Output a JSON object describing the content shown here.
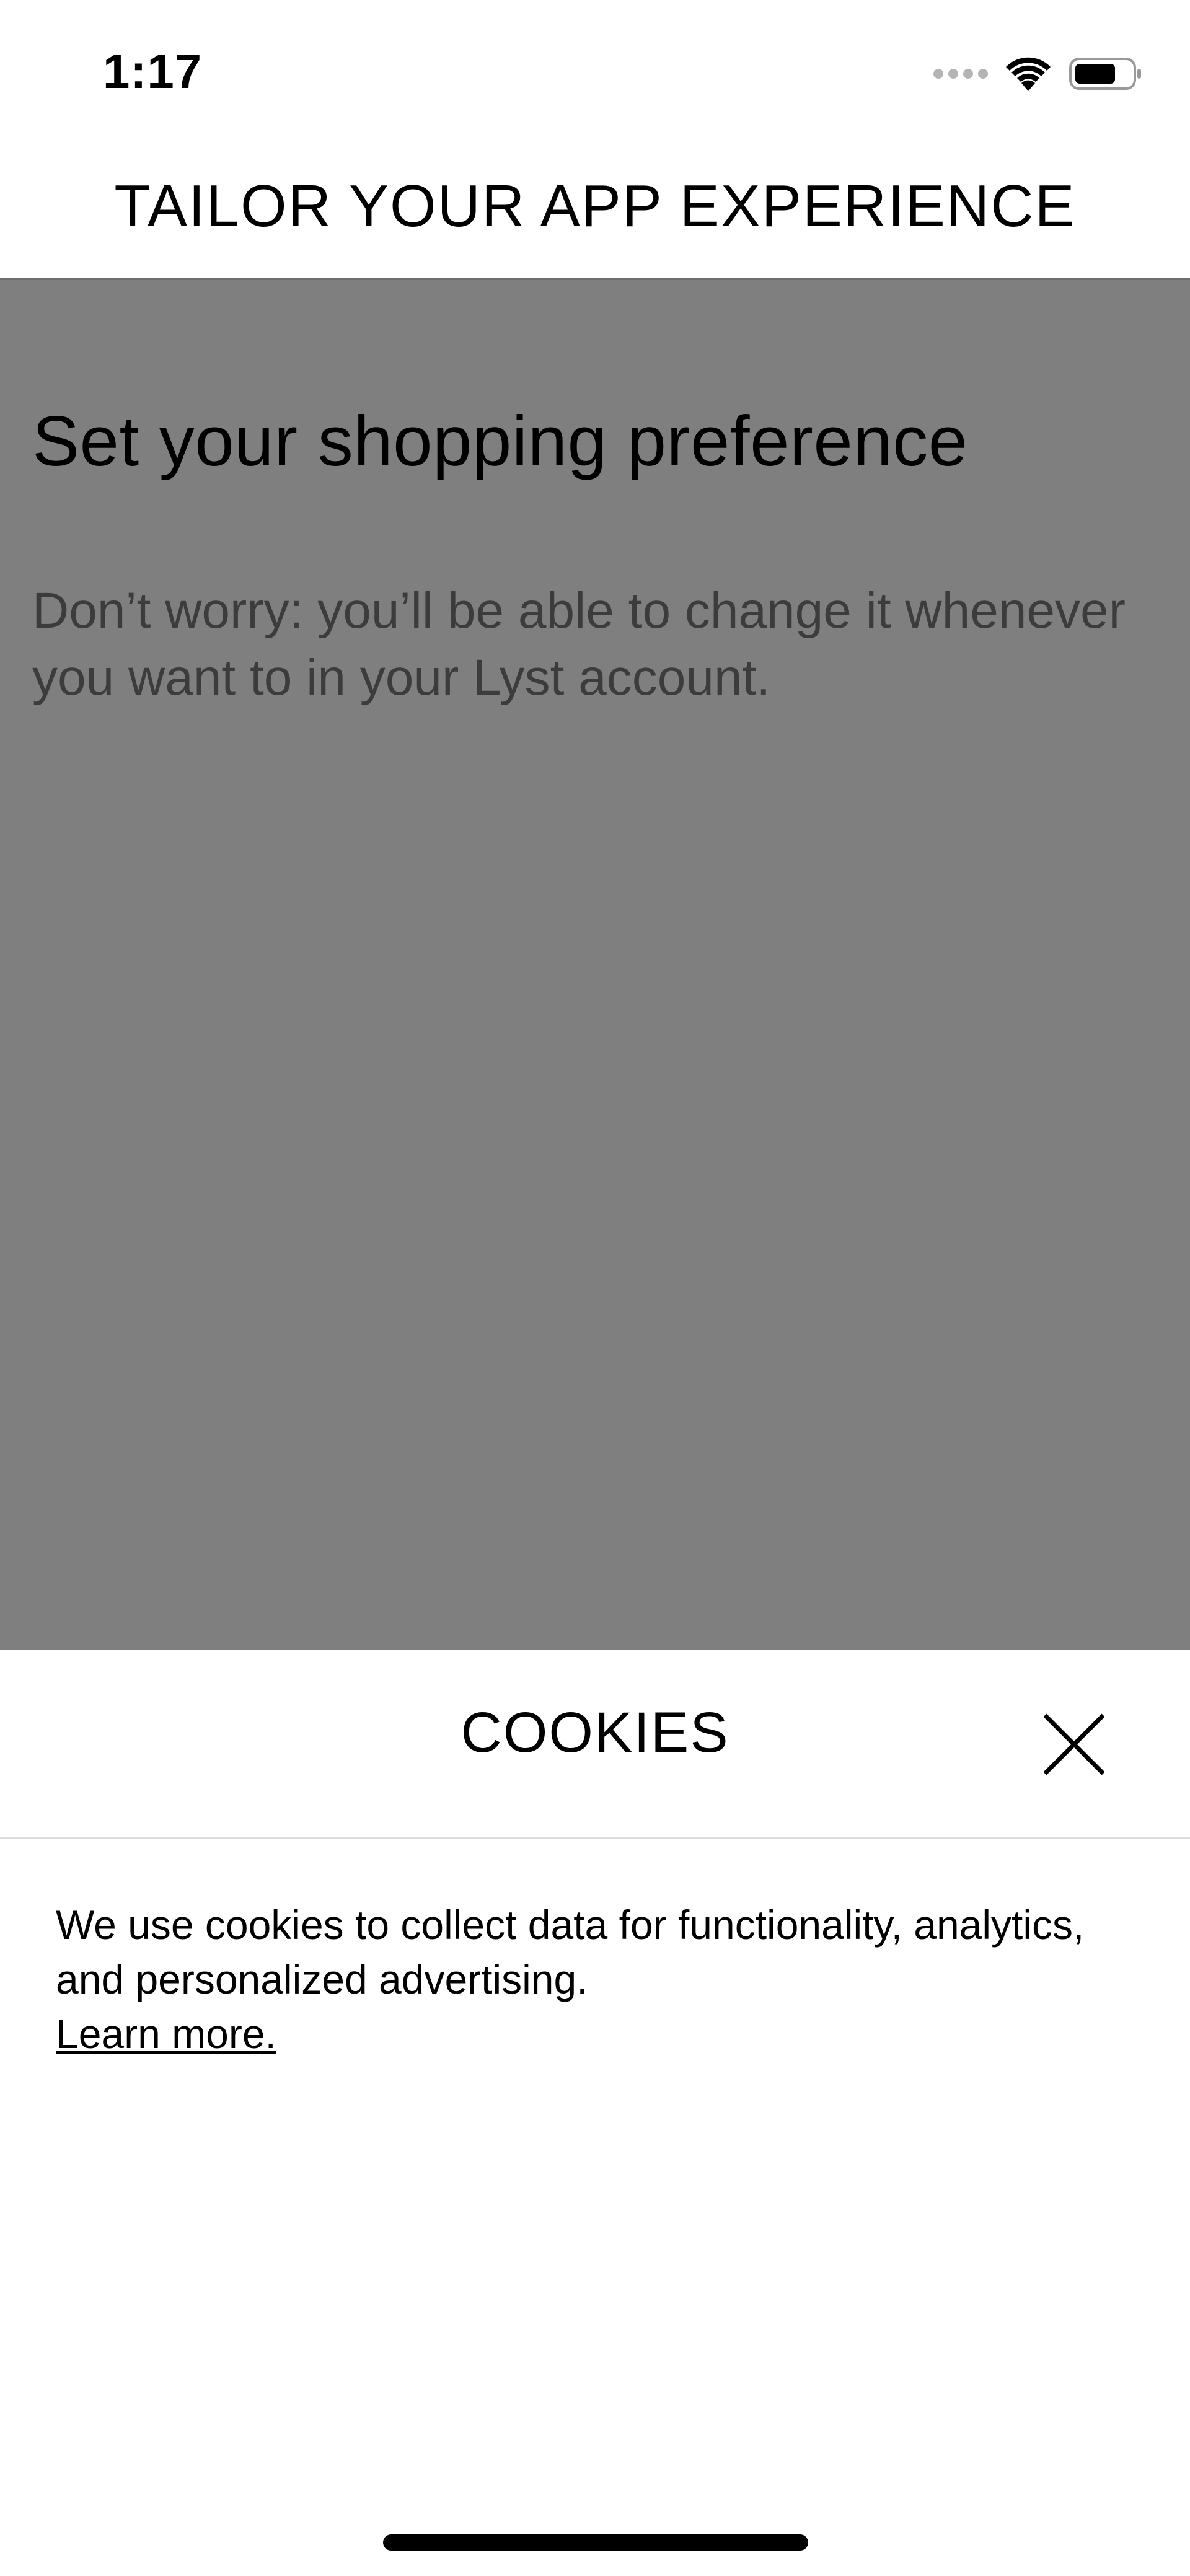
{
  "status_bar": {
    "time": "1:17",
    "icons": [
      "signal-icon",
      "wifi-icon",
      "battery-icon"
    ]
  },
  "header": {
    "title": "TAILOR YOUR APP EXPERIENCE"
  },
  "preference": {
    "heading": "Set your shopping preference",
    "subtext": "Don’t worry: you’ll be able to change it whenever you want to in your Lyst account."
  },
  "cookies": {
    "title": "COOKIES",
    "close_icon": "close-icon",
    "body": "We use cookies to collect data for functionality, analytics, and personalized advertising.",
    "learn_more": "Learn more."
  },
  "colors": {
    "overlay": "#7f7f7f",
    "subtext": "#3c3c3c",
    "sheet_background": "#ffffff",
    "divider": "#dddddd"
  }
}
